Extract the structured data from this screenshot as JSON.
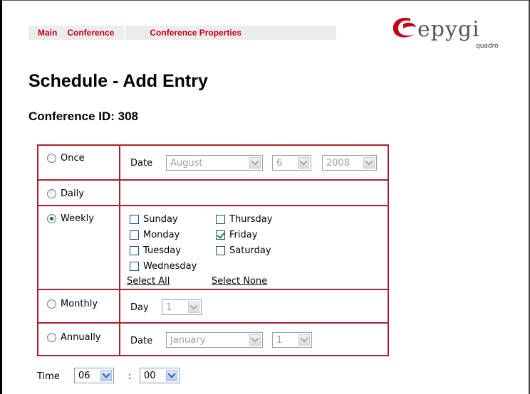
{
  "nav": {
    "main": "Main",
    "conference": "Conference",
    "conference_properties": "Conference Properties"
  },
  "logo": {
    "brand": "epygi",
    "sub": "quadro",
    "icon": "epygi-swoosh-logo"
  },
  "page": {
    "title": "Schedule - Add Entry",
    "conference_id": "Conference ID: 308"
  },
  "colors": {
    "accent_red": "#c0001a",
    "border_red": "#a8212e",
    "nav_bg": "#ececec"
  },
  "schedule": {
    "once": {
      "label": "Once",
      "date_label": "Date",
      "month": "August",
      "day": "6",
      "year": "2008"
    },
    "daily": {
      "label": "Daily"
    },
    "weekly": {
      "label": "Weekly",
      "selected": true,
      "days": [
        {
          "label": "Sunday",
          "checked": false
        },
        {
          "label": "Monday",
          "checked": false
        },
        {
          "label": "Tuesday",
          "checked": false
        },
        {
          "label": "Wednesday",
          "checked": false
        },
        {
          "label": "Thursday",
          "checked": false
        },
        {
          "label": "Friday",
          "checked": true
        },
        {
          "label": "Saturday",
          "checked": false
        }
      ],
      "select_all": "Select All",
      "select_none": "Select None"
    },
    "monthly": {
      "label": "Monthly",
      "day_label": "Day",
      "day": "1"
    },
    "annually": {
      "label": "Annually",
      "date_label": "Date",
      "month": "January",
      "day": "1"
    }
  },
  "time": {
    "label": "Time",
    "hour": "06",
    "separator": ":",
    "minute": "00"
  }
}
